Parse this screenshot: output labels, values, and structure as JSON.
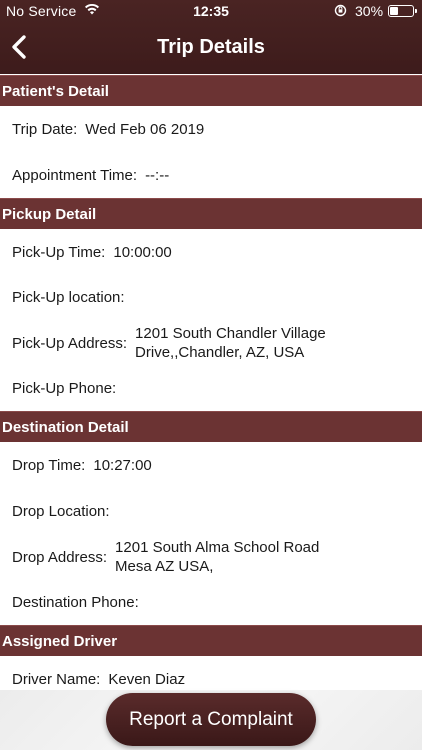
{
  "status_bar": {
    "carrier": "No Service",
    "time": "12:35",
    "battery": "30%"
  },
  "nav": {
    "title": "Trip Details"
  },
  "sections": {
    "patient": {
      "header": "Patient's Detail",
      "trip_date_label": "Trip Date:",
      "trip_date_value": "Wed Feb 06 2019",
      "appointment_label": "Appointment Time:",
      "appointment_value": "--:--"
    },
    "pickup": {
      "header": "Pickup Detail",
      "time_label": "Pick-Up Time:",
      "time_value": "10:00:00",
      "location_label": "Pick-Up location:",
      "location_value": "",
      "address_label": "Pick-Up Address:",
      "address_value": "1201 South Chandler Village Drive,,Chandler, AZ, USA",
      "phone_label": "Pick-Up Phone:",
      "phone_value": ""
    },
    "destination": {
      "header": "Destination Detail",
      "time_label": "Drop Time:",
      "time_value": "10:27:00",
      "location_label": "Drop Location:",
      "location_value": "",
      "address_label": "Drop Address:",
      "address_value": "1201 South Alma School Road Mesa AZ USA,",
      "phone_label": "Destination Phone:",
      "phone_value": ""
    },
    "driver": {
      "header": "Assigned Driver",
      "name_label": "Driver Name:",
      "name_value": "Keven Diaz"
    }
  },
  "footer": {
    "complaint_label": "Report a Complaint"
  },
  "colors": {
    "nav_bg": "#3d1b1b",
    "section_bg": "#6b3333",
    "button_bg": "#4a2222"
  }
}
